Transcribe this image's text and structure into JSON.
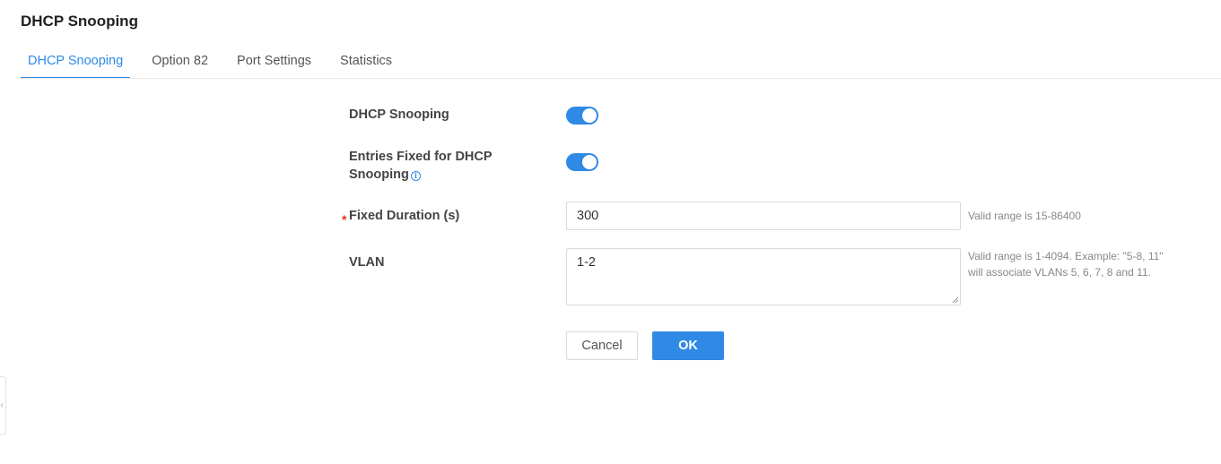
{
  "page": {
    "title": "DHCP Snooping"
  },
  "tabs": [
    {
      "label": "DHCP Snooping",
      "active": true
    },
    {
      "label": "Option 82",
      "active": false
    },
    {
      "label": "Port Settings",
      "active": false
    },
    {
      "label": "Statistics",
      "active": false
    }
  ],
  "form": {
    "dhcp_snooping": {
      "label": "DHCP Snooping",
      "enabled": true
    },
    "entries_fixed": {
      "label_line1": "Entries Fixed for DHCP",
      "label_line2": "Snooping",
      "enabled": true
    },
    "fixed_duration": {
      "label": "Fixed Duration (s)",
      "required_mark": "*",
      "value": "300",
      "hint": "Valid range is 15-86400"
    },
    "vlan": {
      "label": "VLAN",
      "value": "1-2",
      "hint_line1": "Valid range is 1-4094. Example: \"5-8, 11\"",
      "hint_line2": "will associate VLANs 5, 6, 7, 8 and 11."
    }
  },
  "buttons": {
    "cancel": "Cancel",
    "ok": "OK"
  },
  "colors": {
    "accent": "#2f8ae5",
    "required": "#e0301e"
  },
  "icons": {
    "info": "info-circle-icon",
    "side_handle": "collapse-arrow-icon"
  }
}
